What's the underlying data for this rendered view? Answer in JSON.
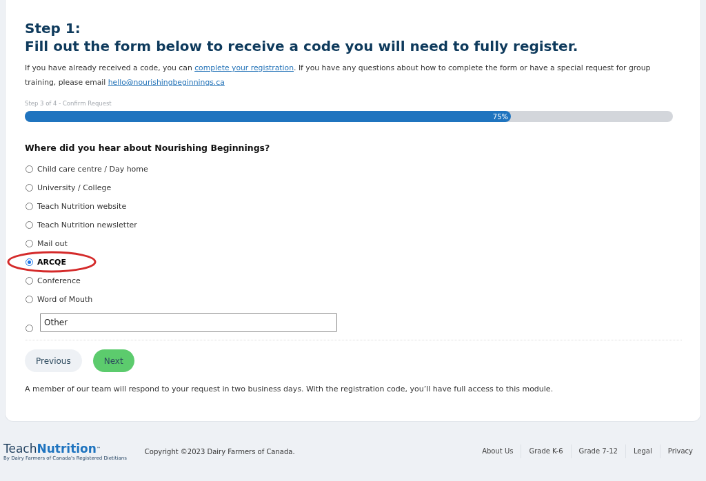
{
  "heading": {
    "step": "Step 1:",
    "title": "Fill out the form below to receive a code you will need to fully register."
  },
  "intro": {
    "before": "If you have already received a code, you can ",
    "link": "complete your registration",
    "middle": ". If you have any questions about how to complete the form or have a special request for group training, please email ",
    "email": "hello@nourishingbeginnings.ca"
  },
  "progress": {
    "label": "Step 3 of 4 - Confirm Request",
    "reading": "75%",
    "level": 0.75
  },
  "question": "Where did you hear about Nourishing Beginnings?",
  "options": [
    {
      "kind": "radio",
      "label": "Child care centre / Day home",
      "selected": false,
      "circled": false
    },
    {
      "kind": "radio",
      "label": "University / College",
      "selected": false,
      "circled": false
    },
    {
      "kind": "radio",
      "label": "Teach Nutrition website",
      "selected": false,
      "circled": false
    },
    {
      "kind": "radio",
      "label": "Teach Nutrition newsletter",
      "selected": false,
      "circled": false
    },
    {
      "kind": "radio",
      "label": "Mail out",
      "selected": false,
      "circled": false
    },
    {
      "kind": "radio",
      "label": "ARCQE",
      "selected": true,
      "circled": true
    },
    {
      "kind": "radio",
      "label": "Conference",
      "selected": false,
      "circled": false
    },
    {
      "kind": "radio",
      "label": "Word of Mouth",
      "selected": false,
      "circled": false
    },
    {
      "kind": "other",
      "placeholder": "Other",
      "selected": false,
      "circled": false
    }
  ],
  "buttons": {
    "previous": "Previous",
    "next": "Next"
  },
  "note": "A member of our team will respond to your request in two business days. With the registration code, you’ll have full access to this module.",
  "footer": {
    "logo": {
      "first": "Teach",
      "second": "Nutrition",
      "mark": "™",
      "tagline": "By Dairy Farmers of Canada's Registered Dietitians"
    },
    "copyright": "Copyright ©2023 Dairy Farmers of Canada.",
    "links": [
      "About Us",
      "Grade K-6",
      "Grade 7-12",
      "Legal",
      "Privacy"
    ]
  }
}
